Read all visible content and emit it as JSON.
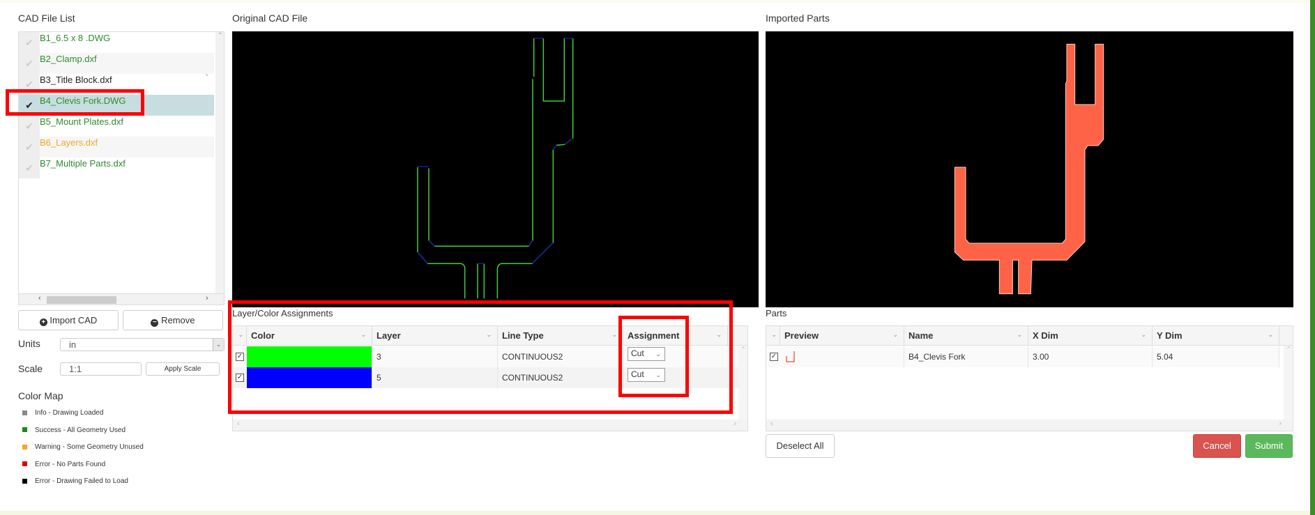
{
  "file_list": {
    "title": "CAD File List",
    "items": [
      {
        "name": "B1_6.5 x 8 .DWG",
        "status": "success",
        "color": "#2e8b2e",
        "checked": false
      },
      {
        "name": "B2_Clamp.dxf",
        "status": "success",
        "color": "#2e8b2e",
        "checked": false
      },
      {
        "name": "B3_Title Block.dxf",
        "status": "error-failed",
        "color": "#222222",
        "checked": false
      },
      {
        "name": "B4_Clevis Fork.DWG",
        "status": "success",
        "color": "#2e8b2e",
        "checked": true,
        "selected": true
      },
      {
        "name": "B5_Mount Plates.dxf",
        "status": "success",
        "color": "#2e8b2e",
        "checked": false
      },
      {
        "name": "B6_Layers.dxf",
        "status": "warning",
        "color": "#f5a623",
        "checked": false
      },
      {
        "name": "B7_Multiple Parts.dxf",
        "status": "success",
        "color": "#2e8b2e",
        "checked": false
      }
    ],
    "import_label": "Import CAD",
    "remove_label": "Remove"
  },
  "settings": {
    "units_label": "Units",
    "units_value": "in",
    "scale_label": "Scale",
    "scale_value": "1:1",
    "apply_scale_label": "Apply Scale"
  },
  "color_map": {
    "title": "Color Map",
    "items": [
      {
        "label": "Info - Drawing Loaded",
        "color": "#888888"
      },
      {
        "label": "Success - All Geometry Used",
        "color": "#1a8a1a"
      },
      {
        "label": "Warning - Some Geometry Unused",
        "color": "#f5a623"
      },
      {
        "label": "Error - No Parts Found",
        "color": "#e00000"
      },
      {
        "label": "Error - Drawing Failed to Load",
        "color": "#000000"
      }
    ]
  },
  "original_cad": {
    "title": "Original CAD File"
  },
  "imported_parts": {
    "title": "Imported Parts",
    "part_color": "#ff6347"
  },
  "layers": {
    "title": "Layer/Color Assignments",
    "columns": [
      "Color",
      "Layer",
      "Line Type",
      "Assignment"
    ],
    "rows": [
      {
        "checked": true,
        "color": "#00ff00",
        "layer": "3",
        "line_type": "CONTINUOUS2",
        "assignment": "Cut"
      },
      {
        "checked": true,
        "color": "#0000ff",
        "layer": "5",
        "line_type": "CONTINUOUS2",
        "assignment": "Cut"
      }
    ]
  },
  "parts": {
    "title": "Parts",
    "columns": [
      "Preview",
      "Name",
      "X Dim",
      "Y Dim"
    ],
    "rows": [
      {
        "checked": true,
        "name": "B4_Clevis Fork",
        "x_dim": "3.00",
        "y_dim": "5.04"
      }
    ],
    "deselect_all_label": "Deselect All",
    "cancel_label": "Cancel",
    "submit_label": "Submit"
  }
}
